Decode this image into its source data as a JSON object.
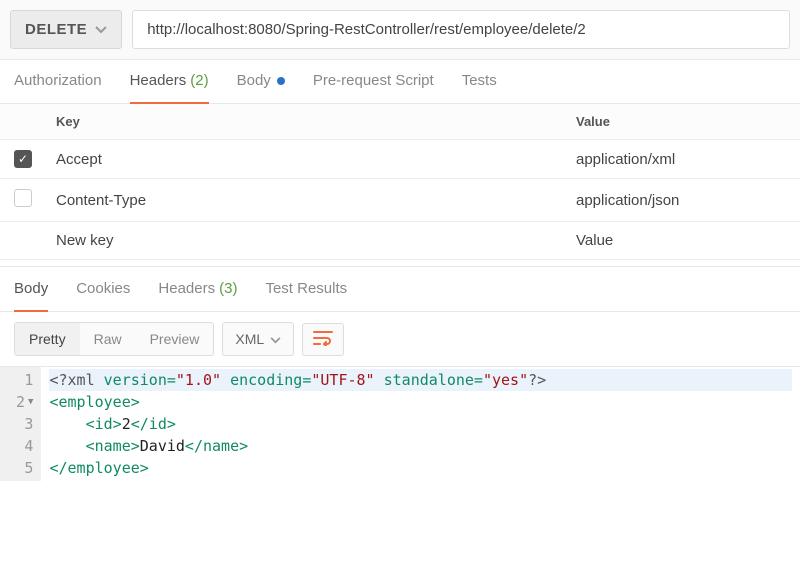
{
  "request": {
    "method": "DELETE",
    "url": "http://localhost:8080/Spring-RestController/rest/employee/delete/2"
  },
  "request_tabs": {
    "authorization": "Authorization",
    "headers": "Headers",
    "headers_count": "(2)",
    "body": "Body",
    "prerequest": "Pre-request Script",
    "tests": "Tests"
  },
  "headers_table": {
    "col_key": "Key",
    "col_value": "Value",
    "rows": [
      {
        "enabled": true,
        "key": "Accept",
        "value": "application/xml"
      },
      {
        "enabled": false,
        "key": "Content-Type",
        "value": "application/json"
      }
    ],
    "placeholder_key": "New key",
    "placeholder_value": "Value"
  },
  "response_tabs": {
    "body": "Body",
    "cookies": "Cookies",
    "headers": "Headers",
    "headers_count": "(3)",
    "tests": "Test Results"
  },
  "response_toolbar": {
    "pretty": "Pretty",
    "raw": "Raw",
    "preview": "Preview",
    "format": "XML"
  },
  "response_body": {
    "lines": [
      1,
      2,
      3,
      4,
      5
    ],
    "xml_decl": {
      "open": "<?xml",
      "attr1": "version=",
      "val1": "\"1.0\"",
      "attr2": "encoding=",
      "val2": "\"UTF-8\"",
      "attr3": "standalone=",
      "val3": "\"yes\"",
      "close": "?>"
    },
    "emp_open": "<employee>",
    "id_open": "<id>",
    "id_text": "2",
    "id_close": "</id>",
    "name_open": "<name>",
    "name_text": "David",
    "name_close": "</name>",
    "emp_close": "</employee>"
  }
}
